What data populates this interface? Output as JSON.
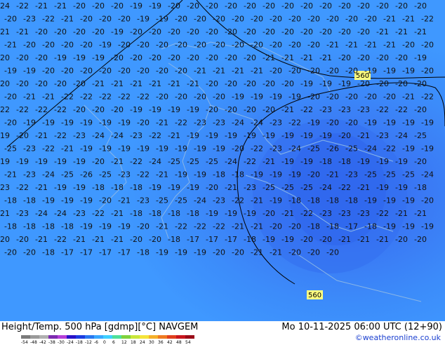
{
  "footer": {
    "title": "Height/Temp. 500 hPa [gdmp][°C] NAVGEM",
    "datetime": "Mo 10-11-2025 06:00 UTC (12+90)",
    "credit": "©weatheronline.co.uk"
  },
  "colorbar": {
    "ticks": [
      "-54",
      "-48",
      "-42",
      "-38",
      "-30",
      "-24",
      "-18",
      "-12",
      "-6",
      "0",
      "6",
      "12",
      "18",
      "24",
      "30",
      "36",
      "42",
      "48",
      "54"
    ],
    "colors": [
      "#7a7a7a",
      "#9a9a9a",
      "#b0b0b0",
      "#7d2bb0",
      "#b63fd8",
      "#2a12c8",
      "#1c3de0",
      "#2a78f0",
      "#3aa8ff",
      "#3fd0ff",
      "#4ee09a",
      "#7fd23c",
      "#c8e63a",
      "#f5e43a",
      "#f5b02a",
      "#ef7a22",
      "#e0401e",
      "#c8161e",
      "#9a0c18"
    ]
  },
  "contours": {
    "label_1": "560",
    "label_2": "560"
  },
  "field_labels": [
    "-24",
    "-22",
    "-21",
    "-21",
    "-20",
    "-20",
    "-20",
    "-19",
    "-19",
    "-20",
    "-20",
    "-20",
    "-20",
    "-20",
    "-20",
    "-20",
    "-20",
    "-20",
    "-20",
    "-20",
    "-20",
    "-20",
    "-20",
    "-20",
    "-23",
    "-22",
    "-21",
    "-20",
    "-20",
    "-20",
    "-19",
    "-19",
    "-20",
    "-20",
    "-20",
    "-20",
    "-20",
    "-20",
    "-20",
    "-20",
    "-20",
    "-20",
    "-20",
    "-21",
    "-21",
    "-22",
    "-21",
    "-21",
    "-20",
    "-20",
    "-20",
    "-20",
    "-19",
    "-20",
    "-20",
    "-20",
    "-20",
    "-20",
    "-20",
    "-20",
    "-20",
    "-20",
    "-20",
    "-20",
    "-20",
    "-20",
    "-21",
    "-21",
    "-21",
    "-21",
    "-20",
    "-20",
    "-20",
    "-20",
    "-19",
    "-20",
    "-20",
    "-20",
    "-20",
    "-20",
    "-20",
    "-20",
    "-20",
    "-20",
    "-20",
    "-20",
    "-21",
    "-21",
    "-21",
    "-21",
    "-20",
    "-20",
    "-20",
    "-20",
    "-20",
    "-19",
    "-19",
    "-19",
    "-20",
    "-20",
    "-20",
    "-20",
    "-20",
    "-20",
    "-20",
    "-20",
    "-21",
    "-21",
    "-21",
    "-21",
    "-20",
    "-20",
    "-20",
    "-20",
    "-19",
    "-19",
    "-19",
    "-20",
    "-20",
    "-20",
    "-20",
    "-20",
    "-20",
    "-20",
    "-20",
    "-21",
    "-21",
    "-21",
    "-21",
    "-20",
    "-20",
    "-20",
    "-20",
    "-20",
    "-19",
    "-19",
    "-19",
    "-20",
    "-20",
    "-20",
    "-20",
    "-20",
    "-20",
    "-21",
    "-21",
    "-21",
    "-21",
    "-21",
    "-21",
    "-20",
    "-20",
    "-20",
    "-20",
    "-20",
    "-19",
    "-19",
    "-19",
    "-20",
    "-20",
    "-20",
    "-20",
    "-20",
    "-21",
    "-21",
    "-22",
    "-22",
    "-22",
    "-22",
    "-22",
    "-20",
    "-20",
    "-20",
    "-20",
    "-19",
    "-19",
    "-19",
    "-19",
    "-20",
    "-20",
    "-20",
    "-20",
    "-20",
    "-21",
    "-22",
    "-22",
    "-22",
    "-22",
    "-22",
    "-20",
    "-20",
    "-20",
    "-19",
    "-19",
    "-19",
    "-19",
    "-20",
    "-20",
    "-20",
    "-20",
    "-21",
    "-22",
    "-23",
    "-23",
    "-23",
    "-22",
    "-22",
    "-20",
    "-20",
    "-19",
    "-19",
    "-19",
    "-19",
    "-19",
    "-19",
    "-20",
    "-21",
    "-22",
    "-23",
    "-23",
    "-24",
    "-24",
    "-23",
    "-22",
    "-19",
    "-20",
    "-20",
    "-19",
    "-19",
    "-19",
    "-19",
    "-19",
    "-20",
    "-21",
    "-22",
    "-23",
    "-24",
    "-24",
    "-23",
    "-22",
    "-21",
    "-19",
    "-19",
    "-19",
    "-19",
    "-19",
    "-19",
    "-19",
    "-19",
    "-20",
    "-21",
    "-23",
    "-24",
    "-25",
    "-25",
    "-23",
    "-22",
    "-21",
    "-19",
    "-19",
    "-19",
    "-19",
    "-19",
    "-19",
    "-19",
    "-19",
    "-20",
    "-22",
    "-23",
    "-24",
    "-25",
    "-26",
    "-25",
    "-24",
    "-22",
    "-19",
    "-19",
    "-19",
    "-19",
    "-19",
    "-19",
    "-19",
    "-20",
    "-21",
    "-22",
    "-24",
    "-25",
    "-25",
    "-25",
    "-24",
    "-22",
    "-21",
    "-19",
    "-19",
    "-18",
    "-18",
    "-19",
    "-19",
    "-19",
    "-20",
    "-21",
    "-23",
    "-24",
    "-25",
    "-26",
    "-25",
    "-23",
    "-22",
    "-21",
    "-19",
    "-19",
    "-18",
    "-18",
    "-19",
    "-19",
    "-19",
    "-20",
    "-21",
    "-23",
    "-25",
    "-25",
    "-25",
    "-24",
    "-23",
    "-22",
    "-21",
    "-19",
    "-19",
    "-18",
    "-18",
    "-18",
    "-19",
    "-19",
    "-19",
    "-20",
    "-21",
    "-23",
    "-25",
    "-25",
    "-25",
    "-24",
    "-22",
    "-21",
    "-19",
    "-19",
    "-18",
    "-18",
    "-18",
    "-19",
    "-19",
    "-19",
    "-20",
    "-21",
    "-23",
    "-25",
    "-25",
    "-24",
    "-23",
    "-22",
    "-21",
    "-19",
    "-18",
    "-18",
    "-18",
    "-18",
    "-19",
    "-19",
    "-19",
    "-20",
    "-21",
    "-23",
    "-24",
    "-24",
    "-23",
    "-22",
    "-21",
    "-18",
    "-18",
    "-18",
    "-18",
    "-19",
    "-19",
    "-19",
    "-20",
    "-21",
    "-22",
    "-23",
    "-23",
    "-23",
    "-22",
    "-21",
    "-21",
    "-18",
    "-18",
    "-18",
    "-18",
    "-19",
    "-19",
    "-19",
    "-20",
    "-21",
    "-22",
    "-22",
    "-22",
    "-21",
    "-21",
    "-20",
    "-20",
    "-18",
    "-18",
    "-17",
    "-18",
    "-19",
    "-19",
    "-19",
    "-20",
    "-20",
    "-21",
    "-22",
    "-21",
    "-21",
    "-21",
    "-20",
    "-20",
    "-18",
    "-17",
    "-17",
    "-17",
    "-18",
    "-19",
    "-19",
    "-20",
    "-20",
    "-21",
    "-21",
    "-21",
    "-20",
    "-20",
    "-20",
    "-20",
    "-18",
    "-17",
    "-17",
    "-17",
    "-17",
    "-18",
    "-19",
    "-19",
    "-19",
    "-20",
    "-20",
    "-21",
    "-21",
    "-20",
    "-20",
    "-20"
  ]
}
